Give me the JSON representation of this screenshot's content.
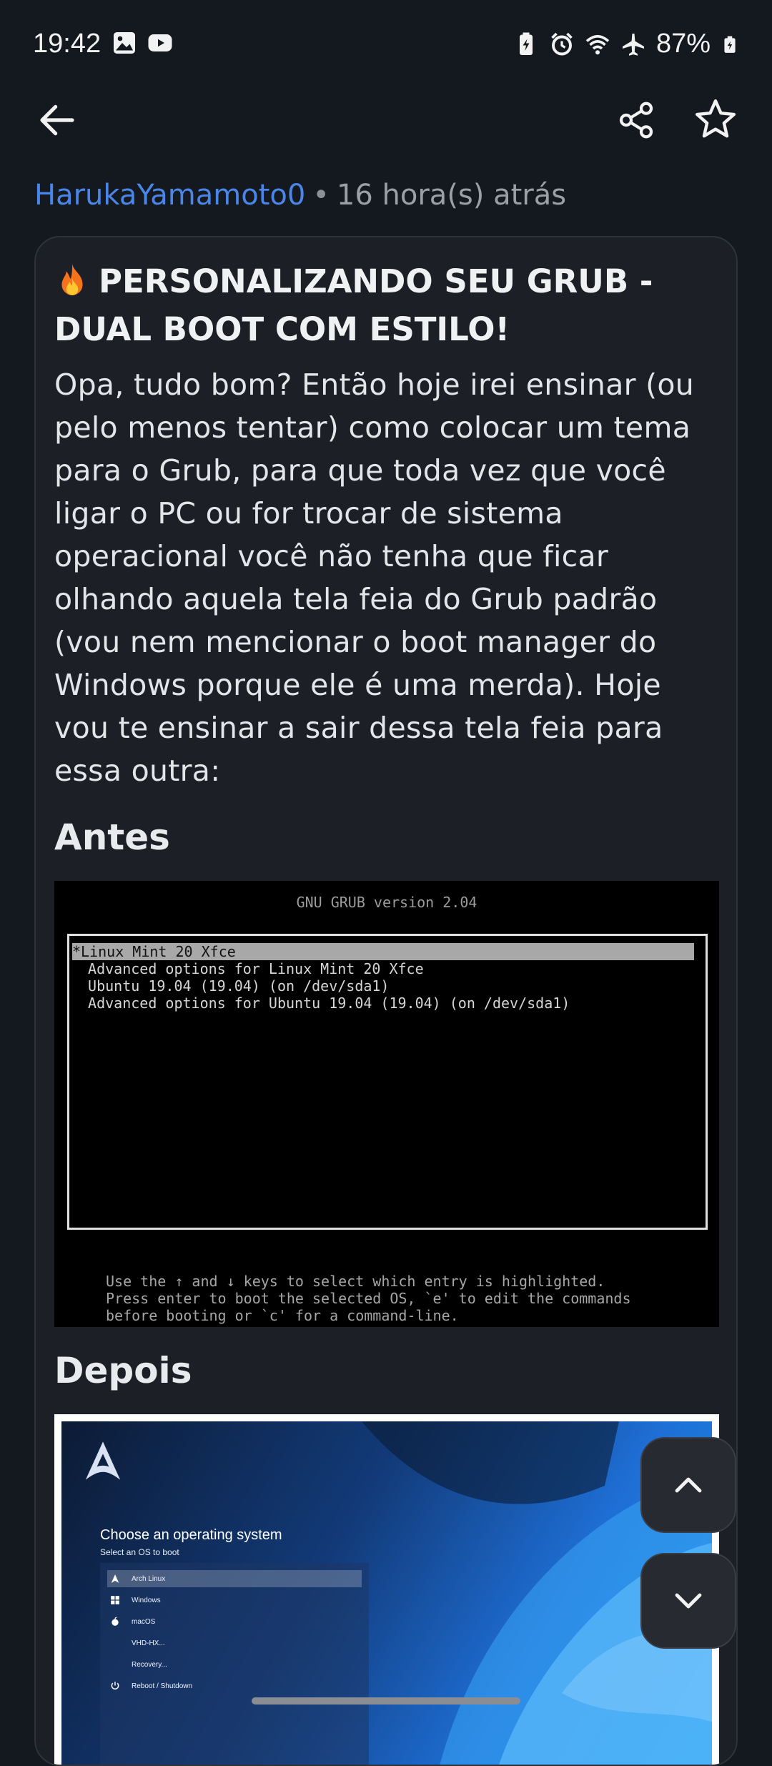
{
  "status_bar": {
    "time": "19:42",
    "battery": "87%",
    "icons_left": [
      "gallery-icon",
      "youtube-icon"
    ],
    "icons_right": [
      "battery-saver-icon",
      "alarm-icon",
      "wifi-icon",
      "airplane-icon",
      "battery-icon"
    ]
  },
  "post": {
    "author": "HarukaYamamoto0",
    "separator": "•",
    "time_ago": "16 hora(s) atrás",
    "title": "PERSONALIZANDO SEU GRUB - DUAL BOOT COM ESTILO!",
    "body": "Opa, tudo bom? Então hoje irei ensinar (ou pelo menos tentar) como colocar um tema para o Grub, para que toda vez que você ligar o PC ou for trocar de sistema operacional você não tenha que ficar olhando aquela tela feia do Grub padrão (vou nem mencionar o boot manager do Windows porque ele é uma merda). Hoje vou te ensinar a sair dessa tela feia para essa outra:",
    "before_heading": "Antes",
    "after_heading": "Depois"
  },
  "grub_before": {
    "header": "GNU GRUB  version 2.04",
    "entries": [
      "*Linux Mint 20 Xfce",
      " Advanced options for Linux Mint 20 Xfce",
      " Ubuntu 19.04 (19.04) (on /dev/sda1)",
      " Advanced options for Ubuntu 19.04 (19.04) (on /dev/sda1)"
    ],
    "help": "Use the ↑ and ↓ keys to select which entry is highlighted.\nPress enter to boot the selected OS, `e' to edit the commands\nbefore booting or `c' for a command-line."
  },
  "grub_after": {
    "title": "Choose an operating system",
    "subtitle": "Select an OS to boot",
    "entries": [
      "Arch Linux",
      "Windows",
      "macOS",
      "VHD-HX...",
      "Recovery...",
      "Reboot / Shutdown"
    ]
  },
  "colors": {
    "background": "#14181f",
    "card": "#1c1f26",
    "author_link": "#4a86e8"
  }
}
